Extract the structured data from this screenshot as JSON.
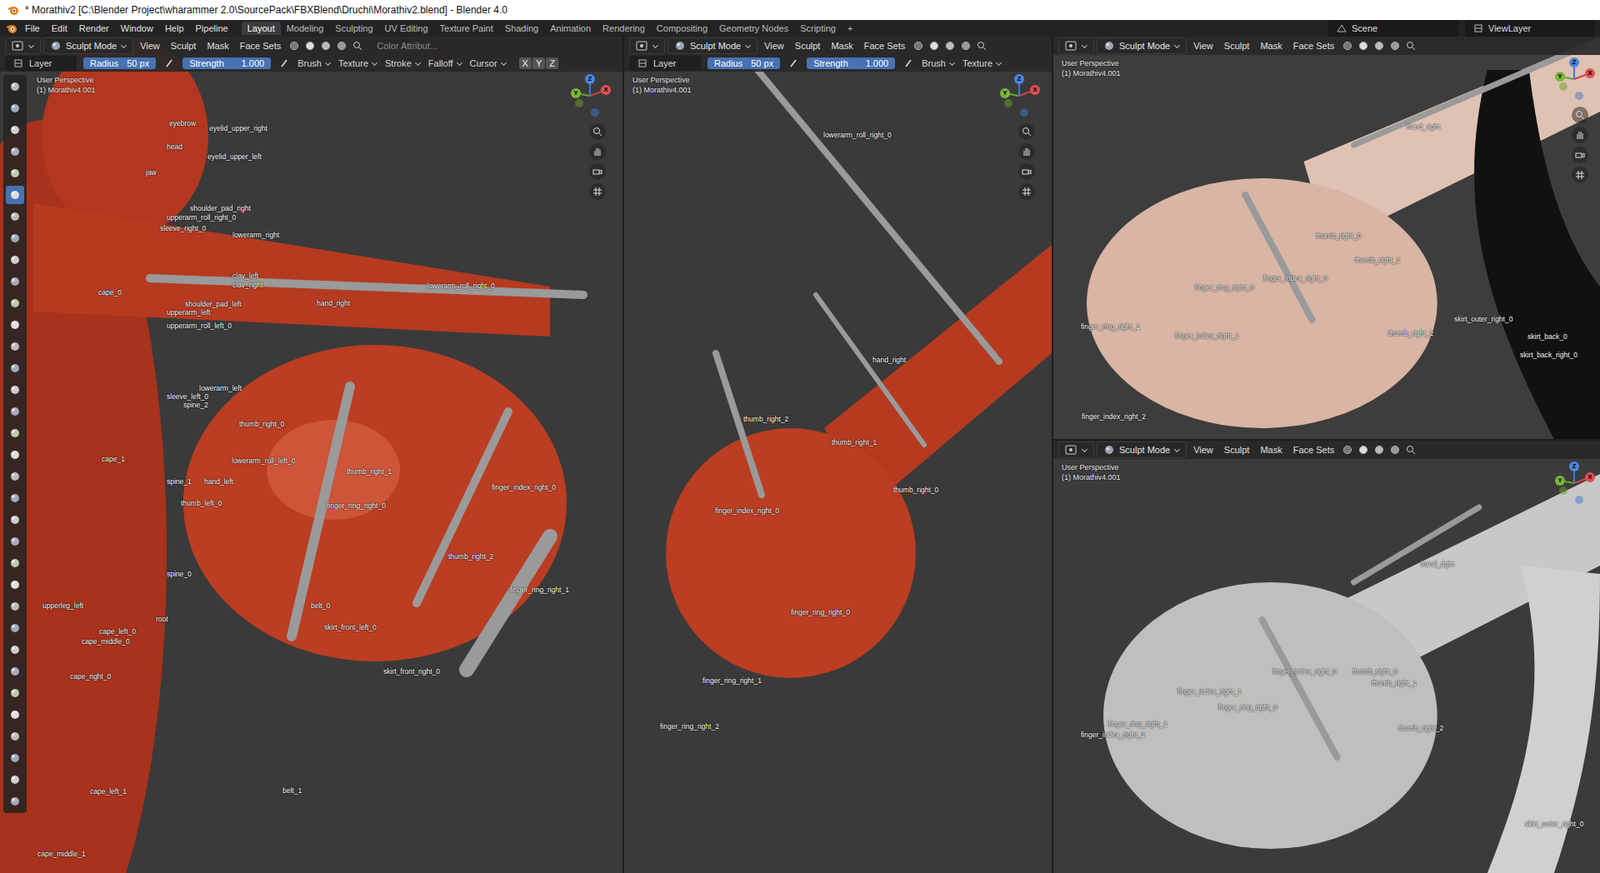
{
  "window": {
    "title": "* Morathiv2 [C:\\Blender Project\\wharammer 2.0\\SourcePack\\FBXBlend\\Druchi\\Morathiv2.blend] - Blender 4.0"
  },
  "menu": [
    "File",
    "Edit",
    "Render",
    "Window",
    "Help",
    "Pipeline"
  ],
  "workspaces": [
    {
      "label": "Layout",
      "selected": true
    },
    {
      "label": "Modeling",
      "selected": false
    },
    {
      "label": "Sculpting",
      "selected": false
    },
    {
      "label": "UV Editing",
      "selected": false
    },
    {
      "label": "Texture Paint",
      "selected": false
    },
    {
      "label": "Shading",
      "selected": false
    },
    {
      "label": "Animation",
      "selected": false
    },
    {
      "label": "Rendering",
      "selected": false
    },
    {
      "label": "Compositing",
      "selected": false
    },
    {
      "label": "Geometry Nodes",
      "selected": false
    },
    {
      "label": "Scripting",
      "selected": false
    }
  ],
  "add_workspace": "+",
  "scene": "Scene",
  "view_layer": "ViewLayer",
  "viewports": [
    {
      "mode": "Sculpt Mode",
      "menus": [
        "View",
        "Sculpt",
        "Mask",
        "Face Sets"
      ],
      "extra": "Color Attribut...",
      "tool_settings": {
        "layer": "Layer",
        "radius_label": "Radius",
        "radius": "50 px",
        "strength_label": "Strength",
        "strength": "1.000",
        "menus": [
          "Brush",
          "Texture",
          "Stroke",
          "Falloff",
          "Cursor"
        ],
        "axes": [
          "X",
          "Y",
          "Z"
        ]
      },
      "view": "User Perspective",
      "object": "(1) Morathiv4.001",
      "gizmo": [
        "X",
        "Y",
        "Z"
      ],
      "toolbar": [
        {
          "selected": false
        },
        {
          "selected": false
        },
        {
          "selected": false
        },
        {
          "selected": false
        },
        {
          "selected": false
        },
        {
          "selected": true
        },
        {
          "selected": false
        },
        {
          "selected": false
        },
        {
          "selected": false
        },
        {
          "selected": false
        },
        {
          "selected": false
        },
        {
          "selected": false
        },
        {
          "selected": false
        },
        {
          "selected": false
        },
        {
          "selected": false
        },
        {
          "selected": false
        },
        {
          "selected": false
        },
        {
          "selected": false
        },
        {
          "selected": false
        },
        {
          "selected": false
        },
        {
          "selected": false
        },
        {
          "selected": false
        },
        {
          "selected": false
        },
        {
          "selected": false
        },
        {
          "selected": false
        },
        {
          "selected": false
        },
        {
          "selected": false
        },
        {
          "selected": false
        },
        {
          "selected": false
        },
        {
          "selected": false
        },
        {
          "selected": false
        },
        {
          "selected": false
        },
        {
          "selected": false
        },
        {
          "selected": false
        }
      ],
      "labels": [
        "eyebrow",
        "eyelid_upper_right",
        "head",
        "eyelid_upper_left",
        "jaw",
        "shoulder_pad_right",
        "upperarm_roll_right_0",
        "sleeve_right_0",
        "lowerarm_right",
        "clav_left",
        "clav_right",
        "lowerarm_roll_right_0",
        "cape_0",
        "shoulder_pad_left",
        "hand_right",
        "upperarm_left",
        "upperarm_roll_left_0",
        "lowerarm_left",
        "sleeve_left_0",
        "spine_2",
        "thumb_right_0",
        "cape_1",
        "lowerarm_roll_left_0",
        "thumb_right_1",
        "spine_1",
        "hand_left",
        "finger_index_right_0",
        "thumb_left_0",
        "finger_ring_right_0",
        "thumb_right_2",
        "spine_0",
        "finger_ring_right_1",
        "upperleg_left",
        "belt_0",
        "root",
        "skirt_front_left_0",
        "cape_left_0",
        "cape_middle_0",
        "cape_right_0",
        "skirt_front_right_0",
        "belt_1",
        "cape_left_1",
        "cape_middle_1"
      ]
    },
    {
      "mode": "Sculpt Mode",
      "menus": [
        "View",
        "Sculpt",
        "Mask",
        "Face Sets"
      ],
      "tool_settings": {
        "layer": "Layer",
        "radius_label": "Radius",
        "radius": "50 px",
        "strength_label": "Strength",
        "strength": "1.000",
        "menus": [
          "Brush",
          "Texture"
        ]
      },
      "view": "User Perspective",
      "object": "(1) Morathiv4.001",
      "gizmo": [
        "X",
        "Y",
        "Z"
      ],
      "labels": [
        "lowerarm_roll_right_0",
        "hand_right",
        "thumb_right_2",
        "thumb_right_1",
        "thumb_right_0",
        "finger_index_right_0",
        "finger_ring_right_0",
        "finger_ring_right_1",
        "finger_ring_right_2"
      ]
    },
    {
      "mode": "Sculpt Mode",
      "menus": [
        "View",
        "Sculpt",
        "Mask",
        "Face Sets"
      ],
      "view": "User Perspective",
      "object": "(1) Morathiv4.001",
      "gizmo": [
        "X",
        "Y",
        "Z"
      ],
      "labels": [
        "hand_right",
        "thumb_right_0",
        "thumb_right_1",
        "finger_index_right_0",
        "finger_ring_right_0",
        "skirt_outer_right_0",
        "finger_ring_right_1",
        "thumb_right_2",
        "finger_index_right_1",
        "skirt_back_0",
        "skirt_back_right_0",
        "finger_index_right_2"
      ]
    },
    {
      "mode": "Sculpt Mode",
      "menus": [
        "View",
        "Sculpt",
        "Mask",
        "Face Sets"
      ],
      "view": "User Perspective",
      "object": "(1) Morathiv4.001",
      "gizmo": [
        "X",
        "Y",
        "Z"
      ],
      "labels": [
        "hand_right",
        "finger_index_right_0",
        "thumb_right_0",
        "thumb_right_1",
        "finger_index_right_1",
        "finger_ring_right_0",
        "finger_ring_right_1",
        "finger_index_right_2",
        "thumb_right_2",
        "skirt_outer_right_0"
      ]
    }
  ]
}
